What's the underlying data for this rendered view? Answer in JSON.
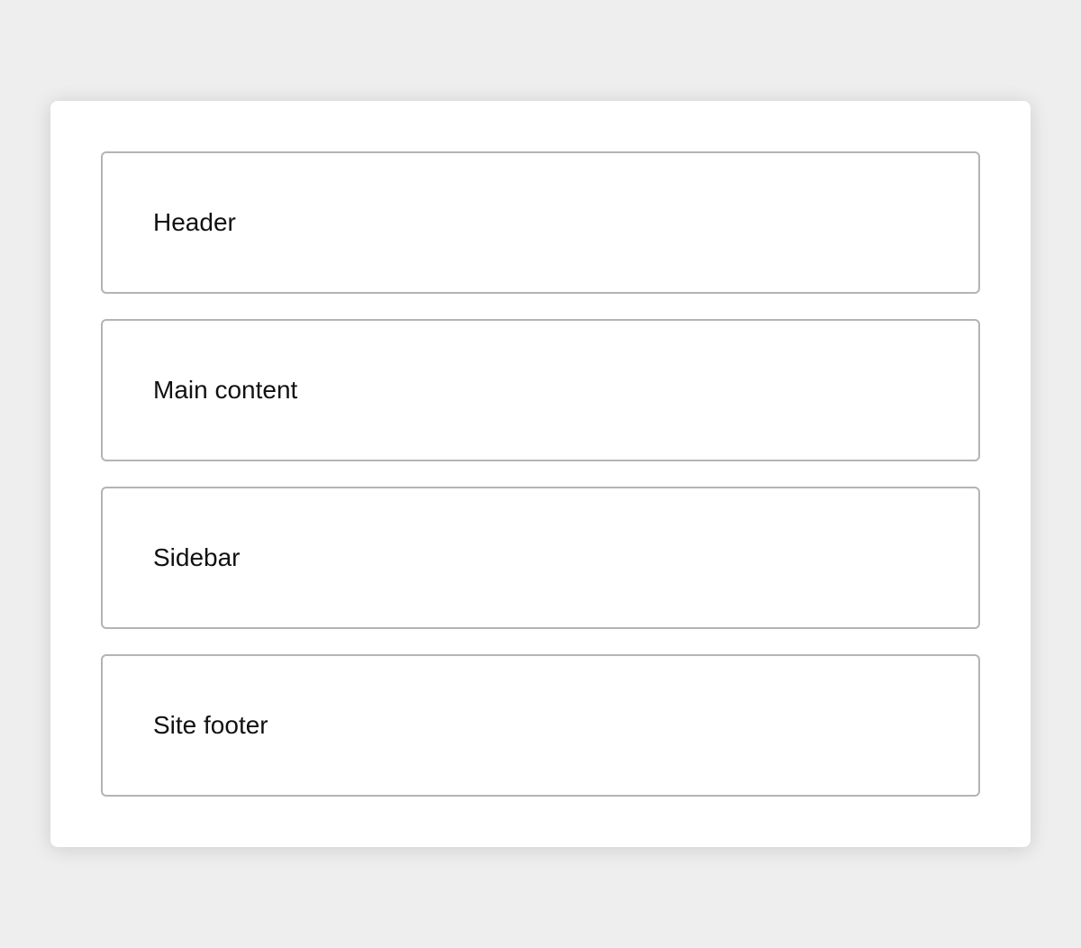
{
  "blocks": [
    {
      "label": "Header"
    },
    {
      "label": "Main content"
    },
    {
      "label": "Sidebar"
    },
    {
      "label": "Site footer"
    }
  ],
  "colors": {
    "page_background": "#eeeeee",
    "card_background": "#ffffff",
    "block_border": "#b4b4b4",
    "text": "#111111"
  }
}
